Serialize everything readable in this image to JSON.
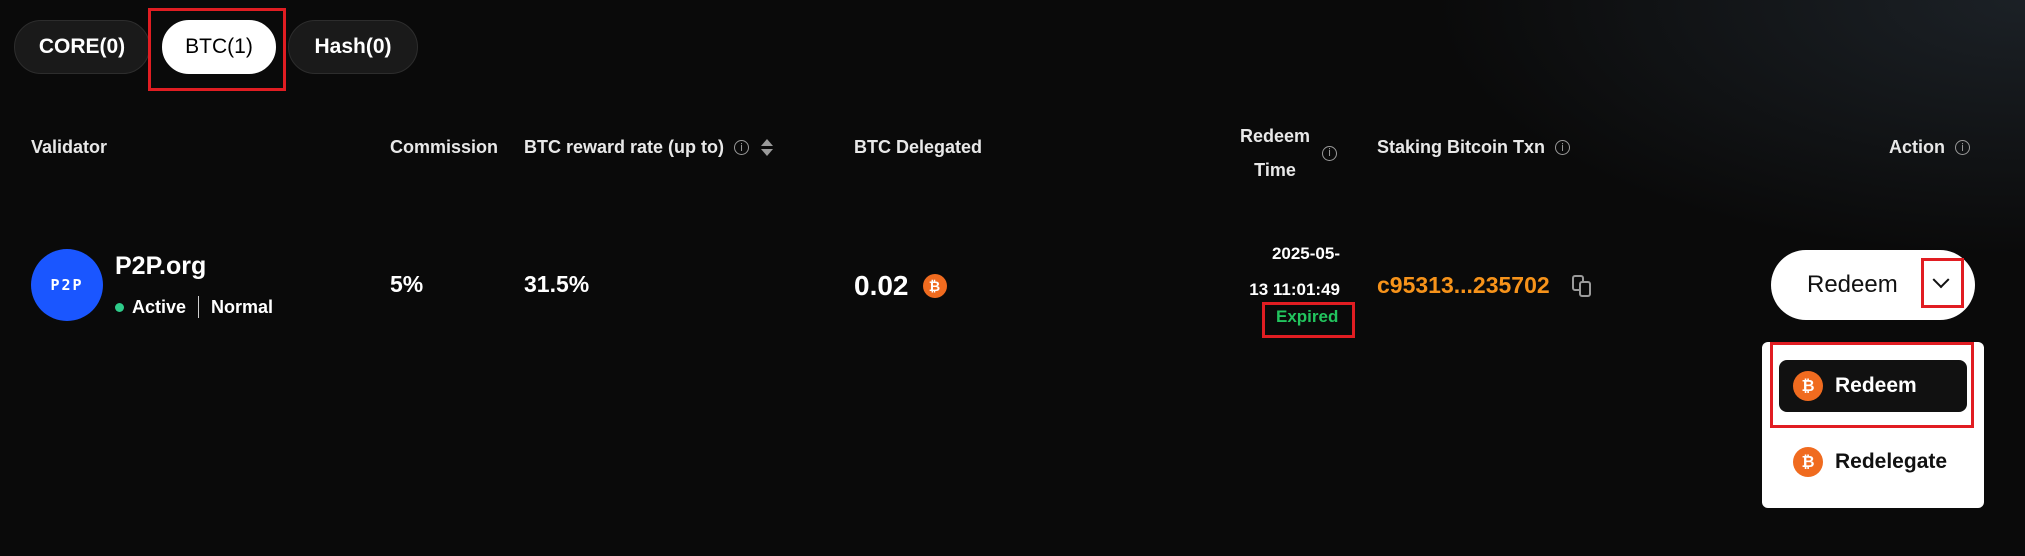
{
  "tabs": [
    {
      "label": "CORE(0)",
      "active": false
    },
    {
      "label": "BTC(1)",
      "active": true
    },
    {
      "label": "Hash(0)",
      "active": false
    }
  ],
  "columns": {
    "validator": "Validator",
    "commission": "Commission",
    "reward_rate": "BTC reward rate (up to)",
    "delegated": "BTC Delegated",
    "redeem_time_line1": "Redeem",
    "redeem_time_line2": "Time",
    "txn": "Staking Bitcoin Txn",
    "action": "Action"
  },
  "row": {
    "logo_text": "P2P",
    "validator_name": "P2P.org",
    "status": "Active",
    "tier": "Normal",
    "commission": "5%",
    "reward_rate": "31.5%",
    "delegated": "0.02",
    "redeem_date": "2025-05-",
    "redeem_clock": "13 11:01:49",
    "redeem_status": "Expired",
    "txn_hash": "c95313...235702",
    "action_label": "Redeem"
  },
  "menu": {
    "items": [
      {
        "label": "Redeem",
        "active": true
      },
      {
        "label": "Redelegate",
        "active": false
      }
    ]
  },
  "icons": {
    "bitcoin_glyph": "₿",
    "info_glyph": "i"
  },
  "colors": {
    "background": "#0a0a0a",
    "accent_orange": "#f7931a",
    "bitcoin_icon": "#f06b1f",
    "status_green": "#2ecc8a",
    "expired_green": "#22c55e",
    "highlight_red": "#e11d22",
    "validator_blue": "#1a56ff"
  }
}
